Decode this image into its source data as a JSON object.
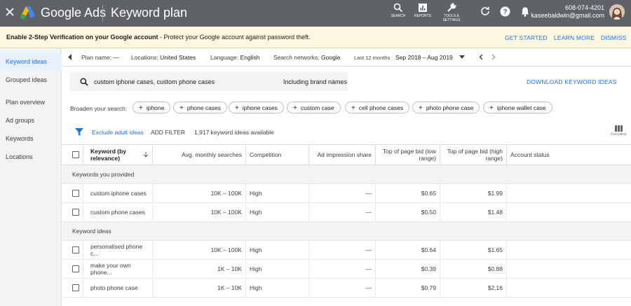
{
  "app": {
    "brand": "Google Ads",
    "title": "Keyword plan"
  },
  "topbar": {
    "tools": [
      {
        "label": "SEARCH",
        "icon": "search-icon"
      },
      {
        "label": "REPORTS",
        "icon": "reports-icon"
      },
      {
        "label": "TOOLS & SETTINGS",
        "icon": "wrench-icon"
      }
    ],
    "phone": "608-074-4201",
    "email": "kaseebaldwin@gmail.com"
  },
  "banner": {
    "bold": "Enable 2-Step Verification on your Google account",
    "text": " - Protect your Google account against password theft.",
    "actions": [
      "GET STARTED",
      "LEARN MORE",
      "DISMISS"
    ]
  },
  "sidebar": {
    "items": [
      "Keyword ideas",
      "Grouped ideas",
      "Plan overview",
      "Ad groups",
      "Keywords",
      "Locations"
    ]
  },
  "filters": {
    "plan_label": "Plan name:",
    "plan_value": "—",
    "locations_label": "Locations:",
    "locations_value": "United States",
    "language_label": "Language:",
    "language_value": "English",
    "networks_label": "Search networks:",
    "networks_value": "Google",
    "range_label": "Last 12 months",
    "range_value": "Sep 2018 – Aug 2019"
  },
  "search": {
    "query": "custom iphone cases, custom phone cases",
    "brand_names": "Including brand names"
  },
  "download_label": "DOWNLOAD KEYWORD IDEAS",
  "broaden": {
    "label": "Broaden your search:",
    "chips": [
      "iphone",
      "phone cases",
      "iphone cases",
      "custom case",
      "cell phone cases",
      "photo phone case",
      "iphone wallet case"
    ]
  },
  "toolbar": {
    "exclude": "Exclude adult ideas",
    "add_filter": "ADD FILTER",
    "count": "1,917 keyword ideas available",
    "columns": "COLUMNS"
  },
  "table": {
    "headers": [
      "Keyword (by relevance)",
      "Avg. monthly searches",
      "Competition",
      "Ad impression share",
      "Top of page bid (low range)",
      "Top of page bid (high range)",
      "Account status"
    ],
    "groups": [
      {
        "title": "Keywords you provided",
        "rows": [
          [
            "custom iphone cases",
            "10K – 100K",
            "High",
            "—",
            "$0.65",
            "$1.99",
            ""
          ],
          [
            "custom phone cases",
            "10K – 100K",
            "High",
            "—",
            "$0.50",
            "$1.48",
            ""
          ]
        ]
      },
      {
        "title": "Keyword ideas",
        "rows": [
          [
            "personalised phone c...",
            "10K – 100K",
            "High",
            "—",
            "$0.64",
            "$1.65",
            ""
          ],
          [
            "make your own phone...",
            "1K – 10K",
            "High",
            "—",
            "$0.39",
            "$0.88",
            ""
          ],
          [
            "photo phone case",
            "1K – 10K",
            "High",
            "—",
            "$0.79",
            "$2.16",
            ""
          ]
        ]
      }
    ]
  }
}
